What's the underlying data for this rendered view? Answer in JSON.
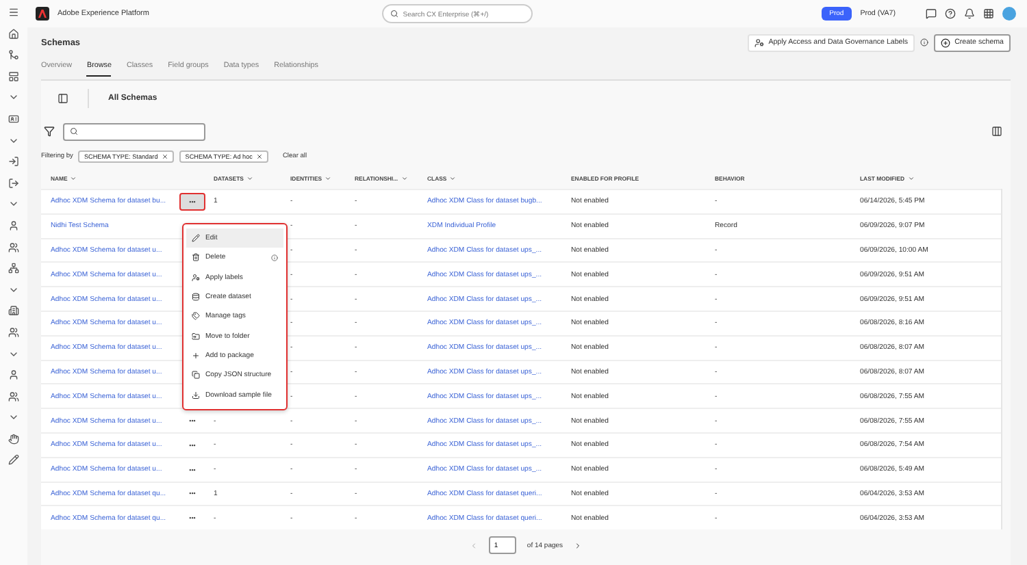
{
  "app": {
    "title": "Adobe Experience Platform",
    "search_placeholder": "Search CX Enterprise (⌘+/)",
    "sandbox_badge": "Prod",
    "sandbox_name": "Prod (VA7)"
  },
  "page": {
    "title": "Schemas",
    "actions": [
      {
        "kind": "labels",
        "label": "Apply Access and Data Governance Labels"
      },
      {
        "kind": "create",
        "label": "Create schema"
      }
    ]
  },
  "tabs": [
    {
      "label": "Overview",
      "selected": false
    },
    {
      "label": "Browse",
      "selected": true
    },
    {
      "label": "Classes",
      "selected": false
    },
    {
      "label": "Field groups",
      "selected": false
    },
    {
      "label": "Data types",
      "selected": false
    },
    {
      "label": "Relationships",
      "selected": false
    }
  ],
  "panel_title": "All Schemas",
  "filters": {
    "label": "Filtering by",
    "chips": [
      "SCHEMA TYPE: Standard",
      "SCHEMA TYPE: Ad hoc"
    ],
    "clear": "Clear all"
  },
  "table": {
    "columns": [
      {
        "label": "NAME",
        "sortable": true
      },
      {
        "label": "DATASETS",
        "sortable": true
      },
      {
        "label": "IDENTITIES",
        "sortable": true
      },
      {
        "label": "RELATIONSHI...",
        "sortable": true
      },
      {
        "label": "CLASS",
        "sortable": true
      },
      {
        "label": "ENABLED FOR PROFILE",
        "sortable": false
      },
      {
        "label": "BEHAVIOR",
        "sortable": false
      },
      {
        "label": "LAST MODIFIED",
        "sortable": true
      }
    ],
    "rows": [
      {
        "name": "Adhoc XDM Schema for dataset bu...",
        "more": "•••",
        "more_selected": true,
        "datasets": "1",
        "identities": "-",
        "relationships": "-",
        "class": "Adhoc XDM Class for dataset bugb...",
        "profile": "Not enabled",
        "behavior": "-",
        "modified": "06/14/2026, 5:45 PM"
      },
      {
        "name": "Nidhi Test Schema",
        "identities": "-",
        "relationships": "-",
        "class": "XDM Individual Profile",
        "profile": "Not enabled",
        "behavior": "Record",
        "modified": "06/09/2026, 9:07 PM"
      },
      {
        "name": "Adhoc XDM Schema for dataset u...",
        "identities": "-",
        "relationships": "-",
        "class": "Adhoc XDM Class for dataset ups_...",
        "profile": "Not enabled",
        "behavior": "-",
        "modified": "06/09/2026, 10:00 AM"
      },
      {
        "name": "Adhoc XDM Schema for dataset u...",
        "identities": "-",
        "relationships": "-",
        "class": "Adhoc XDM Class for dataset ups_...",
        "profile": "Not enabled",
        "behavior": "-",
        "modified": "06/09/2026, 9:51 AM"
      },
      {
        "name": "Adhoc XDM Schema for dataset u...",
        "identities": "-",
        "relationships": "-",
        "class": "Adhoc XDM Class for dataset ups_...",
        "profile": "Not enabled",
        "behavior": "-",
        "modified": "06/09/2026, 9:51 AM"
      },
      {
        "name": "Adhoc XDM Schema for dataset u...",
        "identities": "-",
        "relationships": "-",
        "class": "Adhoc XDM Class for dataset ups_...",
        "profile": "Not enabled",
        "behavior": "-",
        "modified": "06/08/2026, 8:16 AM"
      },
      {
        "name": "Adhoc XDM Schema for dataset u...",
        "identities": "-",
        "relationships": "-",
        "class": "Adhoc XDM Class for dataset ups_...",
        "profile": "Not enabled",
        "behavior": "-",
        "modified": "06/08/2026, 8:07 AM"
      },
      {
        "name": "Adhoc XDM Schema for dataset u...",
        "identities": "-",
        "relationships": "-",
        "class": "Adhoc XDM Class for dataset ups_...",
        "profile": "Not enabled",
        "behavior": "-",
        "modified": "06/08/2026, 8:07 AM"
      },
      {
        "name": "Adhoc XDM Schema for dataset u...",
        "identities": "-",
        "relationships": "-",
        "class": "Adhoc XDM Class for dataset ups_...",
        "profile": "Not enabled",
        "behavior": "-",
        "modified": "06/08/2026, 7:55 AM"
      },
      {
        "name": "Adhoc XDM Schema for dataset u...",
        "more": "•••",
        "more_selected": false,
        "datasets": "-",
        "identities": "-",
        "relationships": "-",
        "class": "Adhoc XDM Class for dataset ups_...",
        "profile": "Not enabled",
        "behavior": "-",
        "modified": "06/08/2026, 7:55 AM"
      },
      {
        "name": "Adhoc XDM Schema for dataset u...",
        "more": "•••",
        "more_selected": false,
        "datasets": "-",
        "identities": "-",
        "relationships": "-",
        "class": "Adhoc XDM Class for dataset ups_...",
        "profile": "Not enabled",
        "behavior": "-",
        "modified": "06/08/2026, 7:54 AM"
      },
      {
        "name": "Adhoc XDM Schema for dataset u...",
        "more": "•••",
        "more_selected": false,
        "datasets": "-",
        "identities": "-",
        "relationships": "-",
        "class": "Adhoc XDM Class for dataset ups_...",
        "profile": "Not enabled",
        "behavior": "-",
        "modified": "06/08/2026, 5:49 AM"
      },
      {
        "name": "Adhoc XDM Schema for dataset qu...",
        "more": "•••",
        "more_selected": false,
        "datasets": "1",
        "identities": "-",
        "relationships": "-",
        "class": "Adhoc XDM Class for dataset queri...",
        "profile": "Not enabled",
        "behavior": "-",
        "modified": "06/04/2026, 3:53 AM"
      },
      {
        "name": "Adhoc XDM Schema for dataset qu...",
        "more": "•••",
        "more_selected": false,
        "datasets": "-",
        "identities": "-",
        "relationships": "-",
        "class": "Adhoc XDM Class for dataset queri...",
        "profile": "Not enabled",
        "behavior": "-",
        "modified": "06/04/2026, 3:53 AM"
      }
    ]
  },
  "menu": {
    "items": [
      {
        "kind": "edit",
        "label": "Edit",
        "selected": true
      },
      {
        "kind": "delete",
        "label": "Delete",
        "selected": false,
        "info": true
      },
      {
        "kind": "labels",
        "label": "Apply labels",
        "selected": false
      },
      {
        "kind": "dataset",
        "label": "Create dataset",
        "selected": false
      },
      {
        "kind": "tags",
        "label": "Manage tags",
        "selected": false
      },
      {
        "kind": "folder",
        "label": "Move to folder",
        "selected": false
      },
      {
        "kind": "package",
        "label": "Add to package",
        "selected": false
      },
      {
        "kind": "copy",
        "label": "Copy JSON structure",
        "selected": false
      },
      {
        "kind": "download",
        "label": "Download sample file",
        "selected": false
      }
    ]
  },
  "pagination": {
    "page": "1",
    "total": "of 14 pages"
  }
}
